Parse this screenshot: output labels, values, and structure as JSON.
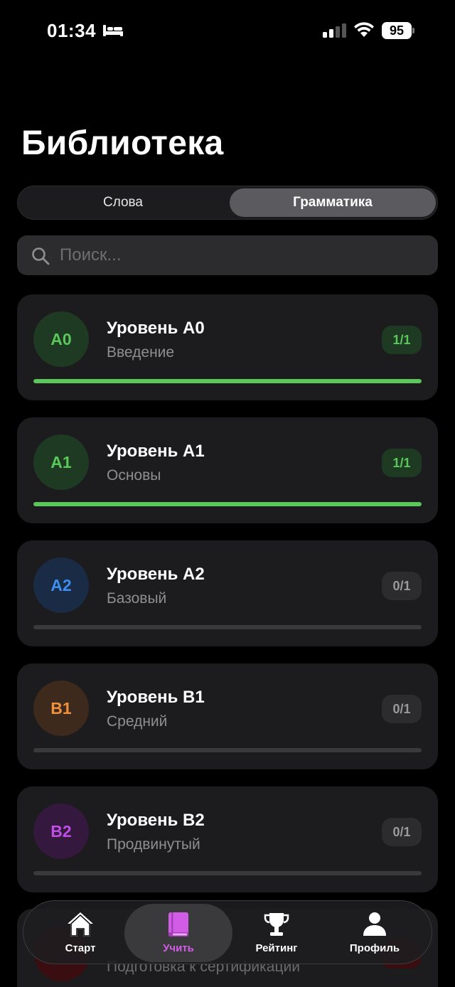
{
  "status_bar": {
    "time": "01:34",
    "battery": "95"
  },
  "page": {
    "title": "Библиотека"
  },
  "segmented_control": {
    "words_label": "Слова",
    "grammar_label": "Грамматика",
    "selected": "Грамматика"
  },
  "search": {
    "placeholder": "Поиск..."
  },
  "levels": [
    {
      "code": "A0",
      "title": "Уровень A0",
      "subtitle": "Введение",
      "count": "1/1",
      "progress": 1.0,
      "color": "#5ac75a",
      "badge_bg": "#1f3a22",
      "pill_bg": "#1f3a22",
      "pill_color": "#5ac75a"
    },
    {
      "code": "A1",
      "title": "Уровень A1",
      "subtitle": "Основы",
      "count": "1/1",
      "progress": 1.0,
      "color": "#5ac75a",
      "badge_bg": "#1f3a22",
      "pill_bg": "#1f3a22",
      "pill_color": "#5ac75a"
    },
    {
      "code": "A2",
      "title": "Уровень A2",
      "subtitle": "Базовый",
      "count": "0/1",
      "progress": 0.0,
      "color": "#3d8ef0",
      "badge_bg": "#1a2b45",
      "pill_bg": "#2c2c2e",
      "pill_color": "#9a9a9e"
    },
    {
      "code": "B1",
      "title": "Уровень B1",
      "subtitle": "Средний",
      "count": "0/1",
      "progress": 0.0,
      "color": "#f0913d",
      "badge_bg": "#3d2a1c",
      "pill_bg": "#2c2c2e",
      "pill_color": "#9a9a9e"
    },
    {
      "code": "B2",
      "title": "Уровень B2",
      "subtitle": "Продвинутый",
      "count": "0/1",
      "progress": 0.0,
      "color": "#c04ee6",
      "badge_bg": "#35183d",
      "pill_bg": "#2c2c2e",
      "pill_color": "#9a9a9e"
    }
  ],
  "partial_card": {
    "subtitle": "Подготовка к сертификации"
  },
  "tab_bar": {
    "items": [
      {
        "label": "Старт",
        "icon": "home-icon"
      },
      {
        "label": "Учить",
        "icon": "book-icon",
        "active": true
      },
      {
        "label": "Рейтинг",
        "icon": "trophy-icon"
      },
      {
        "label": "Профиль",
        "icon": "person-icon"
      }
    ],
    "active_color": "#d35ce6"
  }
}
